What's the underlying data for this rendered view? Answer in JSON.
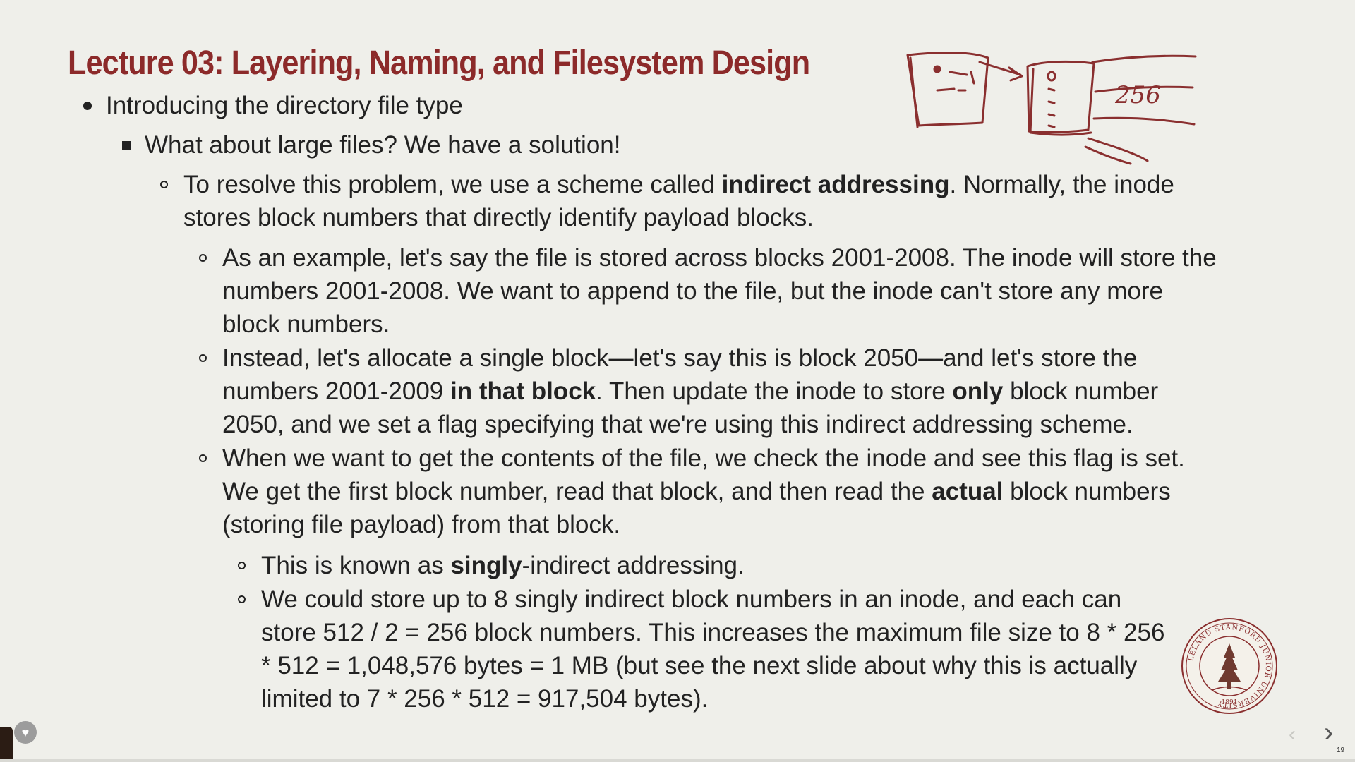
{
  "slide": {
    "title": "Lecture 03: Layering, Naming, and Filesystem Design",
    "l1": "Introducing the directory file type",
    "l2": "What about large files? We have a solution!",
    "p1": {
      "a": "To resolve this problem, we use a scheme called ",
      "b": "indirect addressing",
      "c": ". Normally, the inode stores block numbers that directly identify payload blocks."
    },
    "p2": "As an example, let's say the file is stored across blocks 2001-2008. The inode will store the numbers 2001-2008. We want to append to the file, but the inode can't store any more block numbers.",
    "p3": {
      "a": "Instead, let's allocate a single block—let's say this is block 2050—and let's store the numbers 2001-2009 ",
      "b": "in that block",
      "c": ". Then update the inode to store ",
      "d": "only",
      "e": " block number 2050, and we set a flag specifying that we're using this indirect addressing scheme."
    },
    "p4": {
      "a": "When we want to get the contents of the file, we check the inode and see this flag is set. We get the first block number, read that block, and then read the ",
      "b": "actual",
      "c": " block numbers (storing file payload) from that block."
    },
    "p5": {
      "a": "This is known as ",
      "b": "singly",
      "c": "-indirect addressing."
    },
    "p6": "We could store up to 8 singly indirect block numbers in an inode, and each can store 512 / 2 = 256 block numbers. This increases the maximum file size to 8 * 256 * 512 = 1,048,576 bytes = 1 MB (but see the next slide about why this is actually limited to 7 * 256 * 512 = 917,504 bytes).",
    "annotation_text": "256",
    "seal_text": "LELAND STANFORD JUNIOR UNIVERSITY",
    "seal_year": "1891"
  },
  "nav": {
    "prev": "‹",
    "next": "›",
    "page": "19"
  },
  "colors": {
    "title": "#8c2a2a",
    "ink": "#8a2f2f",
    "background": "#efefea"
  },
  "icons": {
    "favorite": "heart-icon",
    "prev": "chevron-left-icon",
    "next": "chevron-right-icon"
  }
}
